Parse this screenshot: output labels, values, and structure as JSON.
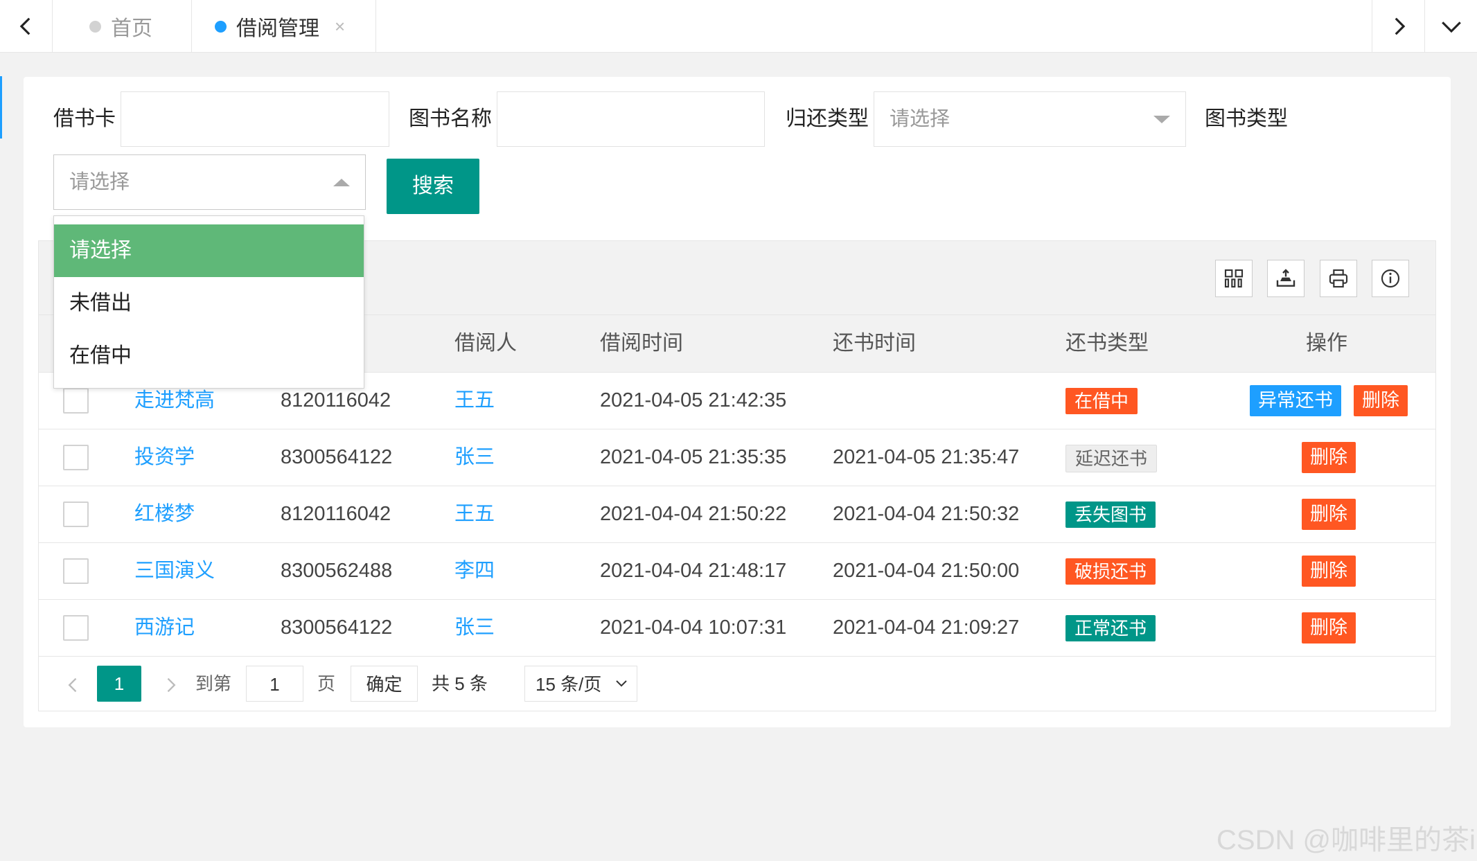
{
  "tabbar": {
    "tabs": [
      {
        "label": "首页",
        "closable": false
      },
      {
        "label": "借阅管理",
        "closable": true,
        "close_glyph": "×"
      }
    ],
    "icons": {
      "prev": "chevron-left-icon",
      "next": "chevron-right-icon",
      "menu": "chevron-down-icon"
    }
  },
  "search": {
    "card_label": "借书卡",
    "card_value": "",
    "book_name_label": "图书名称",
    "book_name_value": "",
    "return_type_label": "归还类型",
    "return_type_value": "请选择",
    "book_type_label": "图书类型",
    "status_value": "请选择",
    "search_button": "搜索"
  },
  "dropdown": {
    "options": [
      {
        "label": "请选择",
        "selected": true
      },
      {
        "label": "未借出",
        "selected": false
      },
      {
        "label": "在借中",
        "selected": false
      }
    ]
  },
  "toolbar": {
    "icons": [
      "columns-icon",
      "export-icon",
      "print-icon",
      "info-icon"
    ]
  },
  "table": {
    "headers": {
      "borrower": "借阅人",
      "borrow_time": "借阅时间",
      "return_time": "还书时间",
      "return_type": "还书类型",
      "actions": "操作"
    },
    "rows": [
      {
        "book": "走进梵高",
        "card": "8120116042",
        "borrower": "王五",
        "borrow_time": "2021-04-05 21:42:35",
        "return_time": "",
        "status": "在借中",
        "status_style": "orange",
        "abnormal_btn": "异常还书",
        "delete_btn": "删除"
      },
      {
        "book": "投资学",
        "card": "8300564122",
        "borrower": "张三",
        "borrow_time": "2021-04-05 21:35:35",
        "return_time": "2021-04-05 21:35:47",
        "status": "延迟还书",
        "status_style": "gray",
        "abnormal_btn": "",
        "delete_btn": "删除"
      },
      {
        "book": "红楼梦",
        "card": "8120116042",
        "borrower": "王五",
        "borrow_time": "2021-04-04 21:50:22",
        "return_time": "2021-04-04 21:50:32",
        "status": "丢失图书",
        "status_style": "green",
        "abnormal_btn": "",
        "delete_btn": "删除"
      },
      {
        "book": "三国演义",
        "card": "8300562488",
        "borrower": "李四",
        "borrow_time": "2021-04-04 21:48:17",
        "return_time": "2021-04-04 21:50:00",
        "status": "破损还书",
        "status_style": "orange",
        "abnormal_btn": "",
        "delete_btn": "删除"
      },
      {
        "book": "西游记",
        "card": "8300564122",
        "borrower": "张三",
        "borrow_time": "2021-04-04 10:07:31",
        "return_time": "2021-04-04 21:09:27",
        "status": "正常还书",
        "status_style": "green",
        "abnormal_btn": "",
        "delete_btn": "删除"
      }
    ]
  },
  "pager": {
    "current": "1",
    "goto_label": "到第",
    "goto_value": "1",
    "page_unit": "页",
    "confirm": "确定",
    "total": "共 5 条",
    "page_size": "15 条/页"
  },
  "watermark": "CSDN @咖啡里的茶i",
  "colors": {
    "primary": "#009688",
    "blue": "#1e9fff",
    "orange": "#ff5722",
    "active_option": "#5fb878"
  }
}
